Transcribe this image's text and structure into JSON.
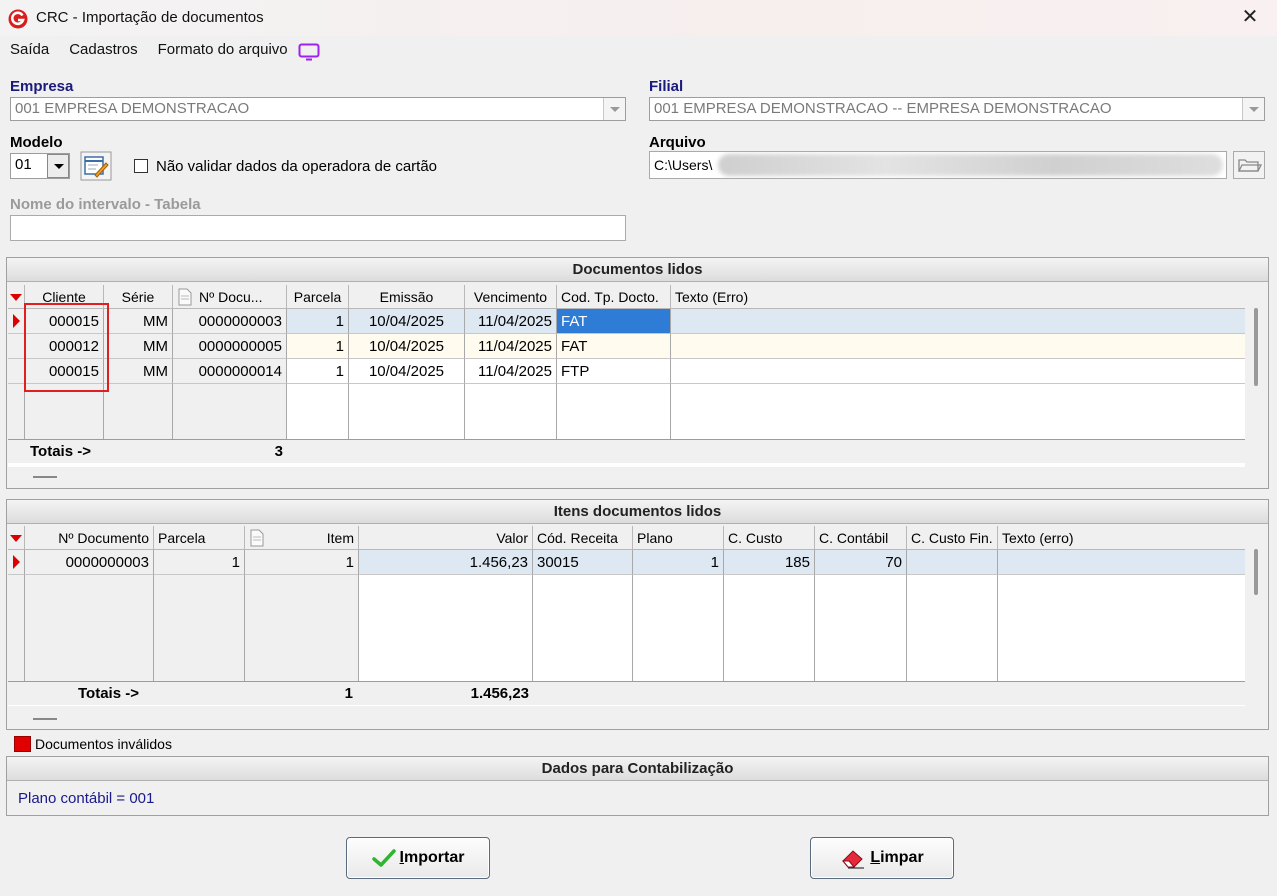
{
  "window": {
    "title": "CRC - Importação de documentos",
    "close_glyph": "✕"
  },
  "menu": {
    "items": [
      "Saída",
      "Cadastros",
      "Formato do arquivo"
    ]
  },
  "empresa": {
    "label": "Empresa",
    "value": "001 EMPRESA DEMONSTRACAO"
  },
  "filial": {
    "label": "Filial",
    "value": "001 EMPRESA DEMONSTRACAO -- EMPRESA DEMONSTRACAO"
  },
  "modelo": {
    "label": "Modelo",
    "value": "01"
  },
  "checkbox": {
    "label": "Não validar dados da operadora de cartão",
    "checked": false
  },
  "arquivo": {
    "label": "Arquivo",
    "value": "C:\\Users\\"
  },
  "intervalo": {
    "label": "Nome do intervalo - Tabela",
    "value": ""
  },
  "documentos": {
    "title": "Documentos lidos",
    "columns": [
      "Cliente",
      "Série",
      "Nº Docu...",
      "Parcela",
      "Emissão",
      "Vencimento",
      "Cod. Tp. Docto.",
      "Texto (Erro)"
    ],
    "rows": [
      [
        "000015",
        "MM",
        "0000000003",
        "1",
        "10/04/2025",
        "11/04/2025",
        "FAT",
        ""
      ],
      [
        "000012",
        "MM",
        "0000000005",
        "1",
        "10/04/2025",
        "11/04/2025",
        "FAT",
        ""
      ],
      [
        "000015",
        "MM",
        "0000000014",
        "1",
        "10/04/2025",
        "11/04/2025",
        "FTP",
        ""
      ]
    ],
    "totals_label": "Totais ->",
    "totals_count": "3"
  },
  "itens": {
    "title": "Itens documentos lidos",
    "columns": [
      "Nº Documento",
      "Parcela",
      "Item",
      "Valor",
      "Cód. Receita",
      "Plano",
      "C. Custo",
      "C. Contábil",
      "C. Custo Fin.",
      "Texto (erro)"
    ],
    "rows": [
      [
        "0000000003",
        "1",
        "1",
        "1.456,23",
        "30015",
        "1",
        "185",
        "70",
        "",
        ""
      ]
    ],
    "totals_label": "Totais ->",
    "totals_count": "1",
    "totals_valor": "1.456,23"
  },
  "legend": {
    "label": "Documentos inválidos",
    "color": "#e00000"
  },
  "contabilizacao": {
    "title": "Dados para Contabilização",
    "plano": "Plano contábil = 001"
  },
  "buttons": {
    "importar_first": "I",
    "importar_rest": "mportar",
    "limpar_first": "L",
    "limpar_rest": "impar"
  },
  "colors": {
    "accent_blue": "#2f7cd6",
    "label_blue": "#1a1a7a",
    "invalid_red": "#e00000"
  }
}
